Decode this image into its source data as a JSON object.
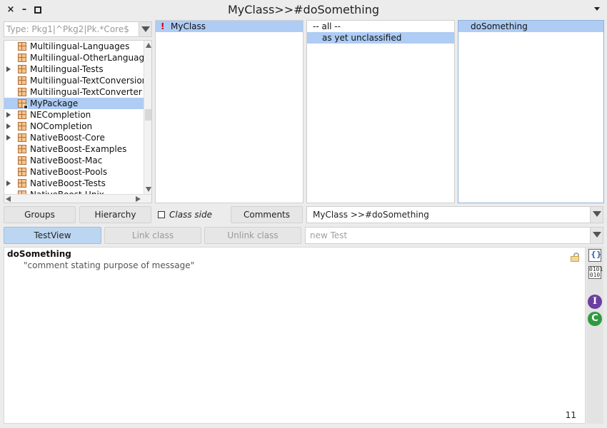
{
  "window": {
    "title": "MyClass>>#doSomething",
    "close_glyph": "×",
    "minimize_glyph": "–"
  },
  "filter": {
    "placeholder": "Type: Pkg1|^Pkg2|Pk.*Core$"
  },
  "packages": [
    {
      "name": "Multilingual-Languages",
      "expandable": false,
      "selected": false
    },
    {
      "name": "Multilingual-OtherLanguages",
      "expandable": false,
      "selected": false
    },
    {
      "name": "Multilingual-Tests",
      "expandable": true,
      "selected": false
    },
    {
      "name": "Multilingual-TextConversion",
      "expandable": false,
      "selected": false
    },
    {
      "name": "Multilingual-TextConverter",
      "expandable": false,
      "selected": false
    },
    {
      "name": "MyPackage",
      "expandable": false,
      "selected": true
    },
    {
      "name": "NECompletion",
      "expandable": true,
      "selected": false
    },
    {
      "name": "NOCompletion",
      "expandable": true,
      "selected": false
    },
    {
      "name": "NativeBoost-Core",
      "expandable": true,
      "selected": false
    },
    {
      "name": "NativeBoost-Examples",
      "expandable": false,
      "selected": false
    },
    {
      "name": "NativeBoost-Mac",
      "expandable": false,
      "selected": false
    },
    {
      "name": "NativeBoost-Pools",
      "expandable": false,
      "selected": false
    },
    {
      "name": "NativeBoost-Tests",
      "expandable": true,
      "selected": false
    },
    {
      "name": "NativeBoost-Unix",
      "expandable": false,
      "selected": false
    }
  ],
  "classes": [
    {
      "name": "MyClass",
      "warning": "!",
      "selected": true
    }
  ],
  "protocols": [
    {
      "name": "-- all --",
      "selected": false
    },
    {
      "name": "as yet unclassified",
      "selected": true
    }
  ],
  "methods": [
    {
      "name": "doSomething",
      "selected": true
    }
  ],
  "toolbar1": {
    "groups": "Groups",
    "hierarchy": "Hierarchy",
    "class_side": "Class side",
    "comments": "Comments",
    "method_combo": "MyClass >>#doSomething"
  },
  "toolbar2": {
    "testview": "TestView",
    "link_class": "Link class",
    "unlink_class": "Unlink class",
    "new_test_placeholder": "new Test"
  },
  "editor": {
    "selector": "doSomething",
    "comment": "\"comment stating purpose of message\"",
    "line_number": "11"
  },
  "tools": {
    "binary_label": "0101 010",
    "info_label": "I",
    "critic_label": "C"
  },
  "colors": {
    "selection": "#aeccf4",
    "warning": "#cc0000",
    "info_icon": "#6a3fa0",
    "critic_icon": "#2f9a3f"
  }
}
